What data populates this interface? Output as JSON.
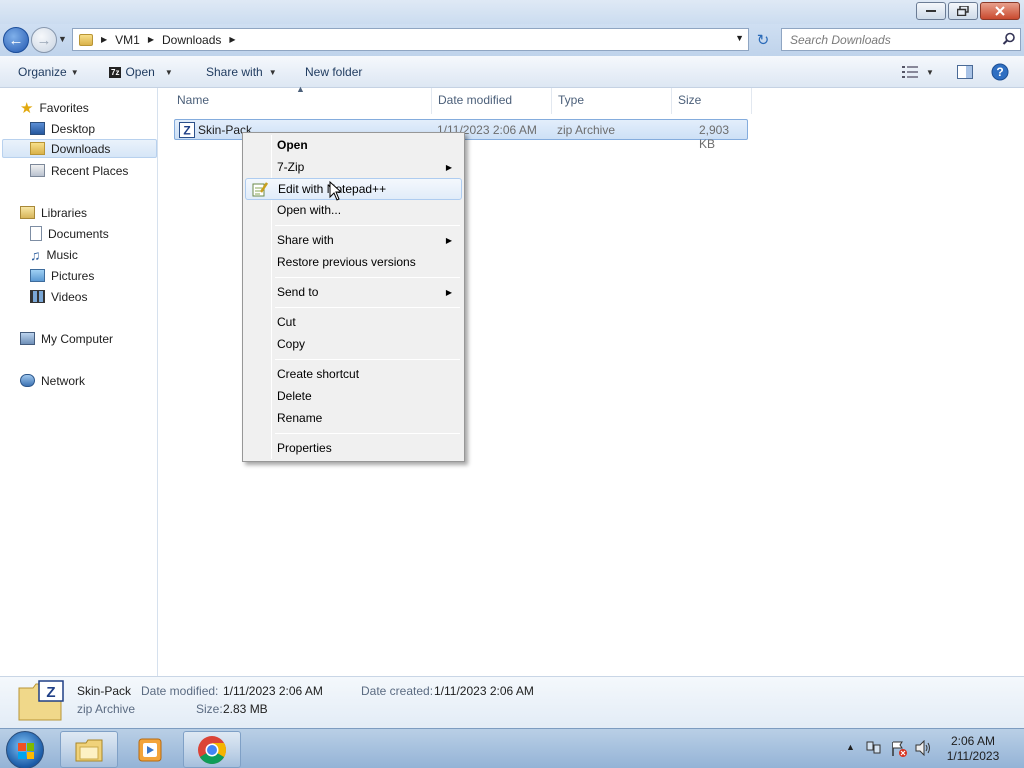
{
  "window": {
    "minimize_icon": "minimize-icon",
    "maximize_icon": "maximize-icon",
    "close_icon": "close-icon"
  },
  "address": {
    "crumbs": [
      "VM1",
      "Downloads"
    ],
    "search_placeholder": "Search Downloads"
  },
  "toolbar": {
    "organize": "Organize",
    "open": "Open",
    "share_with": "Share with",
    "new_folder": "New folder"
  },
  "nav": {
    "favorites": "Favorites",
    "desktop": "Desktop",
    "downloads": "Downloads",
    "recent_places": "Recent Places",
    "libraries": "Libraries",
    "documents": "Documents",
    "music": "Music",
    "pictures": "Pictures",
    "videos": "Videos",
    "my_computer": "My Computer",
    "network": "Network"
  },
  "columns": {
    "name": "Name",
    "date_modified": "Date modified",
    "type": "Type",
    "size": "Size"
  },
  "files": [
    {
      "name": "Skin-Pack",
      "date_modified": "1/11/2023 2:06 AM",
      "type": "zip Archive",
      "size": "2,903 KB"
    }
  ],
  "context_menu": {
    "open": "Open",
    "zip": "7-Zip",
    "edit_notepad": "Edit with Notepad++",
    "open_with": "Open with...",
    "share_with": "Share with",
    "restore": "Restore previous versions",
    "send_to": "Send to",
    "cut": "Cut",
    "copy": "Copy",
    "create_shortcut": "Create shortcut",
    "delete": "Delete",
    "rename": "Rename",
    "properties": "Properties"
  },
  "details": {
    "name": "Skin-Pack",
    "type": "zip Archive",
    "date_modified_label": "Date modified:",
    "date_modified": "1/11/2023 2:06 AM",
    "size_label": "Size:",
    "size": "2.83 MB",
    "date_created_label": "Date created:",
    "date_created": "1/11/2023 2:06 AM"
  },
  "taskbar": {
    "time": "2:06 AM",
    "date": "1/11/2023"
  }
}
